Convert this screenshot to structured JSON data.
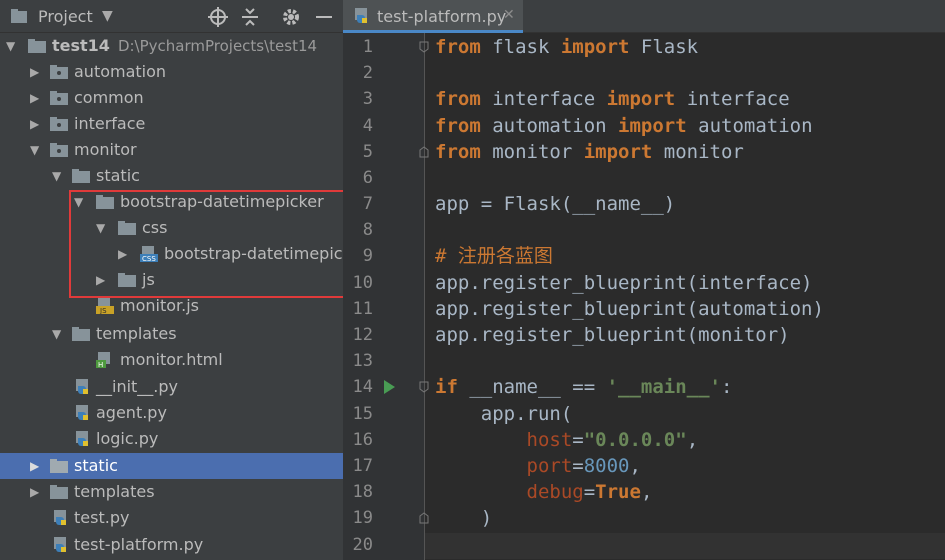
{
  "project_panel": {
    "title": "Project",
    "tree": [
      {
        "label": "test14",
        "path": "D:\\PycharmProjects\\test14",
        "expanded": true
      },
      {
        "label": "automation"
      },
      {
        "label": "common"
      },
      {
        "label": "interface"
      },
      {
        "label": "monitor"
      },
      {
        "label": "static"
      },
      {
        "label": "bootstrap-datetimepicker"
      },
      {
        "label": "css"
      },
      {
        "label": "bootstrap-datetimepicke"
      },
      {
        "label": "js"
      },
      {
        "label": "monitor.js"
      },
      {
        "label": "templates"
      },
      {
        "label": "monitor.html"
      },
      {
        "label": "__init__.py"
      },
      {
        "label": "agent.py"
      },
      {
        "label": "logic.py"
      },
      {
        "label": "static",
        "selected": true
      },
      {
        "label": "templates"
      },
      {
        "label": "test.py"
      },
      {
        "label": "test-platform.py"
      }
    ]
  },
  "editor": {
    "tab_label": "test-platform.py",
    "line_numbers": [
      "1",
      "2",
      "3",
      "4",
      "5",
      "6",
      "7",
      "8",
      "9",
      "10",
      "11",
      "12",
      "13",
      "14",
      "15",
      "16",
      "17",
      "18",
      "19",
      "20"
    ],
    "comment": "# 注册各蓝图",
    "strings": {
      "host": "\"0.0.0.0\"",
      "main": "'__main__'"
    },
    "port": "8000"
  },
  "colors": {
    "accent_selection": "#4b6eaf",
    "annotation": "#e03a3a"
  }
}
